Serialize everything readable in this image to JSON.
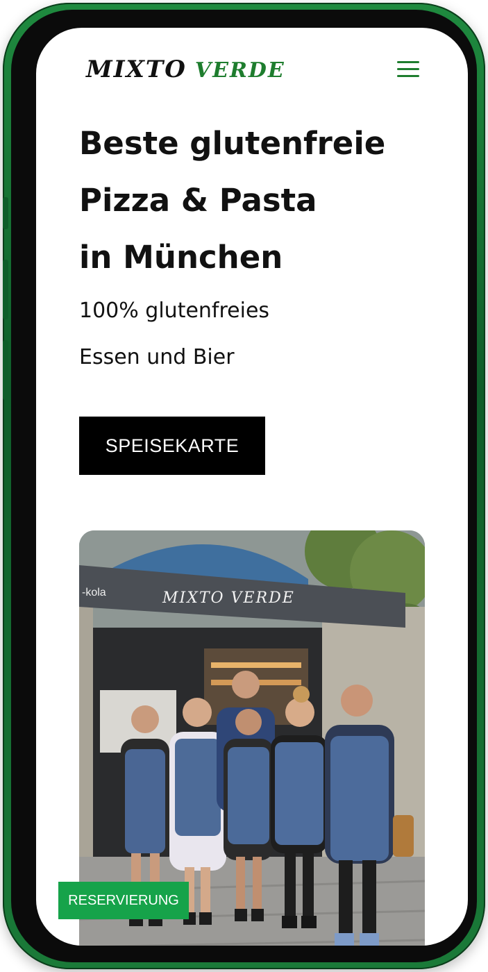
{
  "brand": {
    "logo_part1": "MIXTO",
    "logo_part2": "VERDE",
    "accent_color": "#1e7d2e",
    "button_green": "#16a34a"
  },
  "header": {
    "menu_icon": "hamburger-icon"
  },
  "hero": {
    "title_lines": [
      "Beste glutenfreie",
      "Pizza & Pasta",
      "in München"
    ],
    "subtitle_lines": [
      "100% glutenfreies",
      "Essen und Bier"
    ],
    "cta_label": "SPEISEKARTE"
  },
  "photo": {
    "awning_text": "MIXTO VERDE",
    "side_sign_text": "-kola"
  },
  "floating": {
    "reservation_label": "RESERVIERUNG"
  }
}
